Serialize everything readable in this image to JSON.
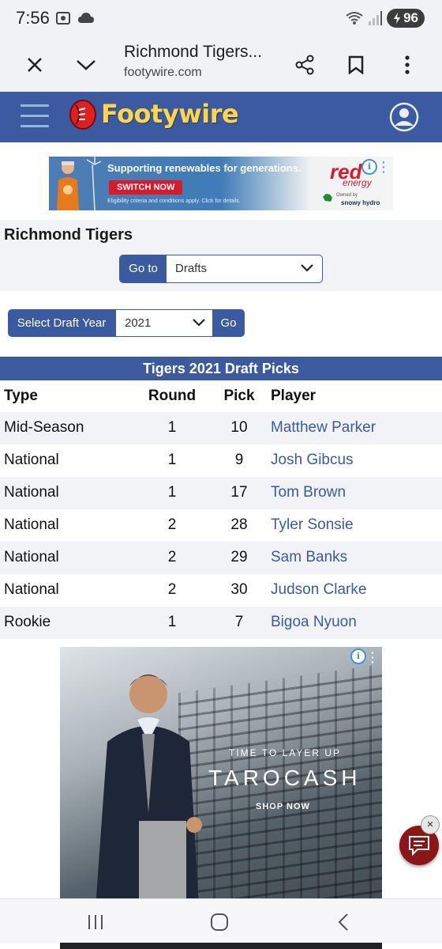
{
  "status_bar": {
    "time": "7:56",
    "battery": "96",
    "left_icons": [
      "screenshot-icon",
      "cloud-icon"
    ],
    "right_icons": [
      "wifi-icon",
      "signal-icon"
    ]
  },
  "browser": {
    "page_title": "Richmond Tigers...",
    "domain": "footywire.com",
    "buttons": [
      "close-icon",
      "chevron-down-icon",
      "share-icon",
      "bookmark-icon",
      "more-icon"
    ]
  },
  "site": {
    "logo_text": "Footywire",
    "brand_color": "#3b5aa0",
    "logo_color": "#ffd64a"
  },
  "ad_top": {
    "headline": "Supporting renewables for generations.",
    "cta": "SWITCH NOW",
    "fine_print": "Eligibility criteria and conditions apply. Click for details.",
    "brand": "red",
    "brand_sub": "energy",
    "owned_by": "Owned by",
    "owner": "snowy hydro"
  },
  "page": {
    "team_title": "Richmond Tigers",
    "goto_label": "Go to",
    "goto_selected": "Drafts",
    "draft_year_label": "Select Draft Year",
    "draft_year_selected": "2021",
    "go_button": "Go"
  },
  "table": {
    "title": "Tigers 2021 Draft Picks",
    "headers": {
      "type": "Type",
      "round": "Round",
      "pick": "Pick",
      "player": "Player"
    },
    "rows": [
      {
        "type": "Mid-Season",
        "round": "1",
        "pick": "10",
        "player": "Matthew Parker"
      },
      {
        "type": "National",
        "round": "1",
        "pick": "9",
        "player": "Josh Gibcus"
      },
      {
        "type": "National",
        "round": "1",
        "pick": "17",
        "player": "Tom Brown"
      },
      {
        "type": "National",
        "round": "2",
        "pick": "28",
        "player": "Tyler Sonsie"
      },
      {
        "type": "National",
        "round": "2",
        "pick": "29",
        "player": "Sam Banks"
      },
      {
        "type": "National",
        "round": "2",
        "pick": "30",
        "player": "Judson Clarke"
      },
      {
        "type": "Rookie",
        "round": "1",
        "pick": "7",
        "player": "Bigoa Nyuon"
      }
    ]
  },
  "ad_bottom": {
    "tagline": "TIME TO LAYER UP",
    "brand": "TAROCASH",
    "cta": "SHOP NOW"
  },
  "chat": {
    "close": "×"
  }
}
